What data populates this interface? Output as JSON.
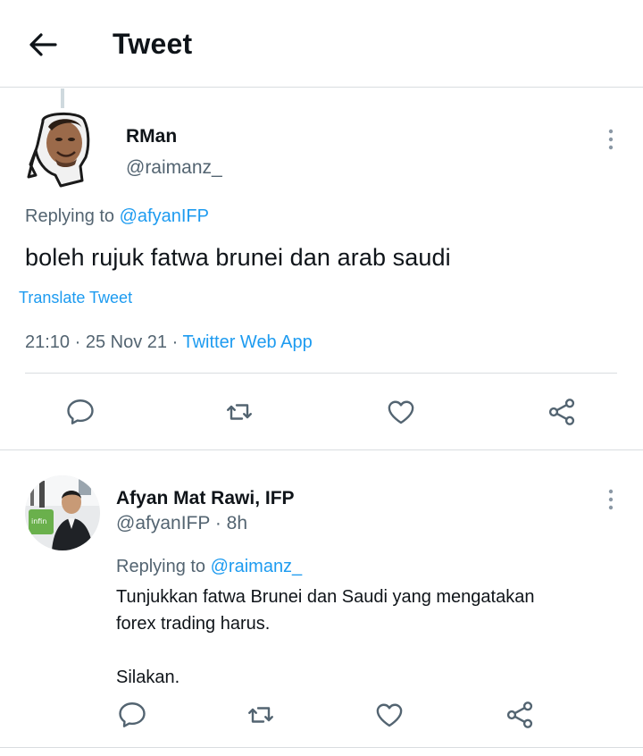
{
  "header": {
    "title": "Tweet",
    "back_icon": "arrow-left-icon"
  },
  "tweet": {
    "author_name": "RMan",
    "author_handle": "@raimanz_",
    "replying_prefix": "Replying to ",
    "replying_to": "@afyanIFP",
    "text": "boleh rujuk fatwa brunei dan arab saudi",
    "translate_label": "Translate Tweet",
    "time": "21:10",
    "date": "25 Nov 21",
    "source": "Twitter Web App",
    "dot": "·"
  },
  "reply": {
    "author_name": "Afyan Mat Rawi, IFP",
    "author_handle": "@afyanIFP",
    "time_ago": "8h",
    "dot": "·",
    "replying_prefix": "Replying to ",
    "replying_to": "@raimanz_",
    "text_line1": "Tunjukkan fatwa Brunei dan Saudi yang mengatakan",
    "text_line2": "forex trading harus.",
    "text_line3": "Silakan.",
    "avatar_badge": "infin"
  },
  "colors": {
    "accent": "#1d9bf0",
    "secondary_text": "#536471",
    "primary_text": "#0f1419",
    "divider": "#d9dde0"
  }
}
